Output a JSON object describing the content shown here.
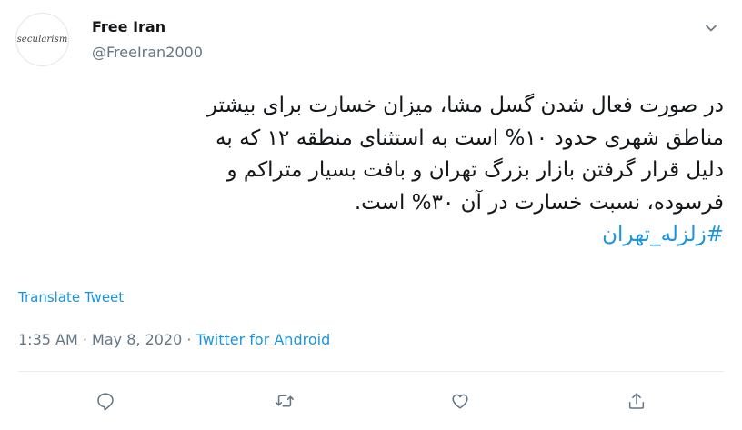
{
  "account": {
    "avatar_text": "secularism",
    "display_name": "Free Iran",
    "handle": "@FreeIran2000"
  },
  "tweet": {
    "lines": [
      "در صورت فعال شدن گسل مشا، میزان خسارت برای بیشتر",
      "مناطق شهری حدود ۱۰% است به استثنای منطقه ۱۲ که به",
      "دلیل قرار گرفتن بازار بزرگ تهران و بافت بسیار متراکم و",
      "فرسوده، نسبت خسارت در آن ۳۰% است."
    ],
    "hashtag": "#زلزله_تهران"
  },
  "translate_label": "Translate Tweet",
  "meta": {
    "time": "1:35 AM",
    "separator": "·",
    "date": "May 8, 2020",
    "source": "Twitter for Android"
  },
  "actions": {
    "reply_icon": "reply-icon",
    "retweet_icon": "retweet-icon",
    "like_icon": "like-icon",
    "share_icon": "share-icon"
  },
  "colors": {
    "link": "#1b95e0",
    "secondary_text": "#657786",
    "primary_text": "#14171a",
    "divider": "#e6ecf0"
  }
}
